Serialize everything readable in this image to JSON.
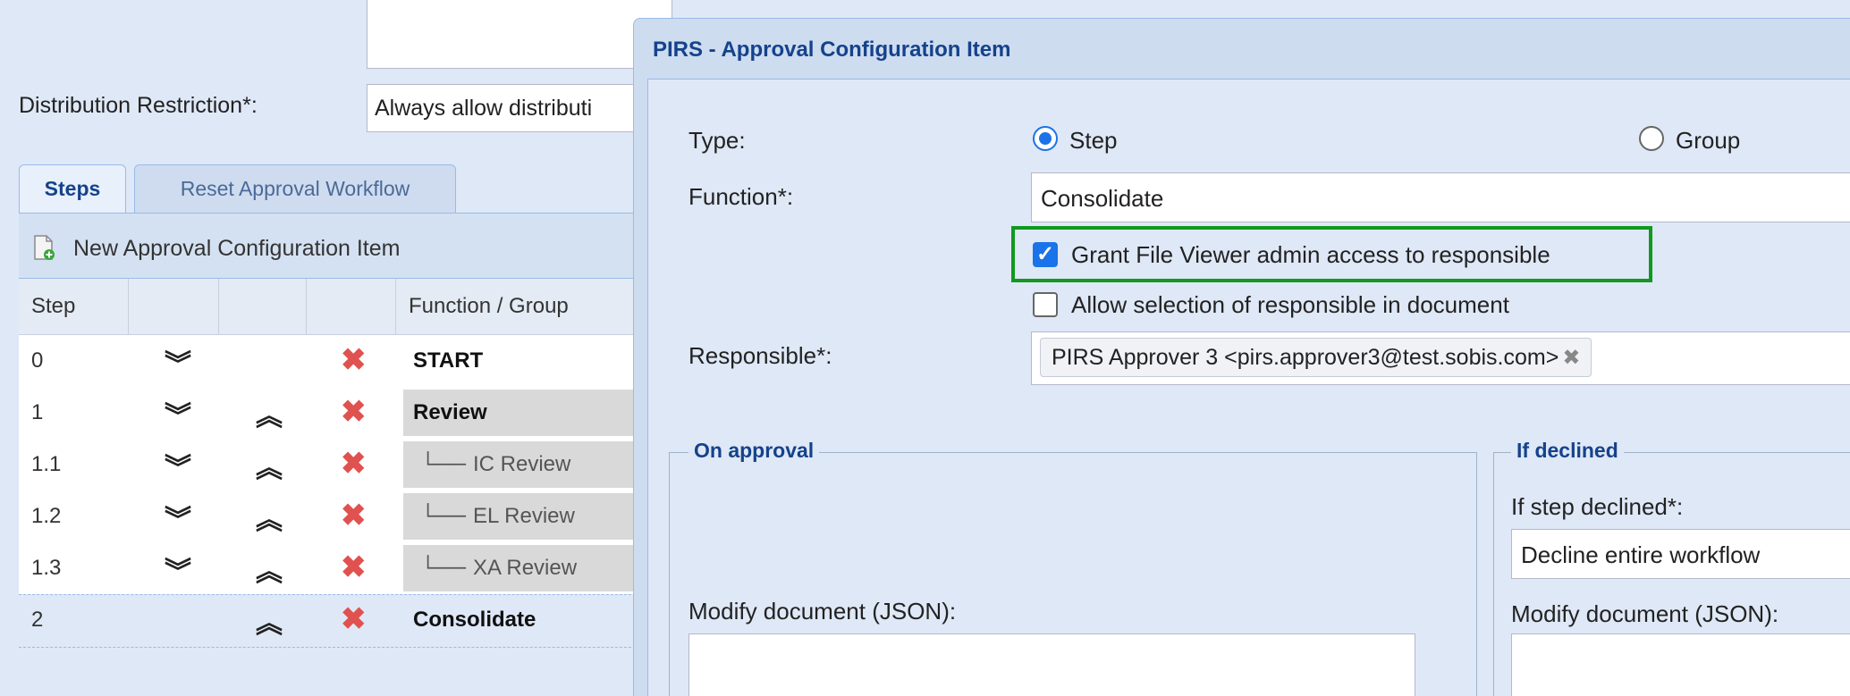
{
  "background": {
    "distribution_label": "Distribution Restriction*:",
    "distribution_value": "Always allow distributi",
    "tabs": [
      {
        "label": "Steps"
      },
      {
        "label": "Reset Approval Workflow"
      }
    ],
    "toolbar": {
      "new_item_label": "New Approval Configuration Item"
    },
    "grid": {
      "headers": {
        "step": "Step",
        "function": "Function / Group"
      },
      "rows": [
        {
          "step": "0",
          "function": "START",
          "tree": "",
          "down": true,
          "up": false
        },
        {
          "step": "1",
          "function": "Review",
          "tree": "",
          "down": true,
          "up": true
        },
        {
          "step": "1.1",
          "function": "IC Review",
          "tree": "└──",
          "down": true,
          "up": true
        },
        {
          "step": "1.2",
          "function": "EL Review",
          "tree": "└──",
          "down": true,
          "up": true
        },
        {
          "step": "1.3",
          "function": "XA Review",
          "tree": "└──",
          "down": true,
          "up": true
        },
        {
          "step": "2",
          "function": "Consolidate",
          "tree": "",
          "down": false,
          "up": true
        }
      ]
    },
    "icons": {
      "down": "double-chevron-down-icon",
      "up": "double-chevron-up-icon",
      "delete": "delete-x-icon",
      "add": "new-document-icon"
    }
  },
  "dialog": {
    "title": "PIRS - Approval Configuration Item",
    "type_label": "Type:",
    "type_options": [
      {
        "label": "Step",
        "selected": true
      },
      {
        "label": "Group",
        "selected": false
      }
    ],
    "function_label": "Function*:",
    "function_value": "Consolidate",
    "grant_checkbox": {
      "label": "Grant File Viewer admin access to responsible",
      "checked": true
    },
    "allow_checkbox": {
      "label": "Allow selection of responsible in document",
      "checked": false
    },
    "responsible_label": "Responsible*:",
    "responsible_value": "PIRS Approver 3 <pirs.approver3@test.sobis.com>",
    "remove_symbol": "✖",
    "on_approval": {
      "legend": "On approval",
      "modify_label": "Modify document (JSON):"
    },
    "if_declined": {
      "legend": "If declined",
      "step_declined_label": "If step declined*:",
      "step_declined_value": "Decline entire workflow",
      "modify_label": "Modify document (JSON):"
    },
    "colors": {
      "highlight": "#119922",
      "accent": "#1a73e8",
      "delete": "#e0524f"
    }
  }
}
